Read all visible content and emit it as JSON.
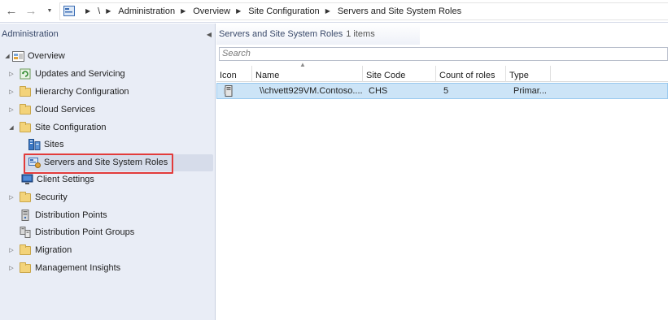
{
  "nav": {
    "back_glyph": "←",
    "forward_glyph": "→",
    "dropdown_glyph": "▼",
    "breadcrumb": [
      "\\",
      "Administration",
      "Overview",
      "Site Configuration",
      "Servers and Site System Roles"
    ]
  },
  "sidebar": {
    "title": "Administration",
    "collapse_glyph": "◀",
    "items": [
      {
        "label": "Overview",
        "icon": "overview-icon",
        "twisty": "◢"
      },
      {
        "label": "Updates and Servicing",
        "icon": "updates-icon",
        "twisty": "▷"
      },
      {
        "label": "Hierarchy Configuration",
        "icon": "folder-icon",
        "twisty": "▷"
      },
      {
        "label": "Cloud Services",
        "icon": "folder-icon",
        "twisty": "▷"
      },
      {
        "label": "Site Configuration",
        "icon": "folder-icon",
        "twisty": "◢"
      },
      {
        "label": "Sites",
        "icon": "sites-icon",
        "twisty": ""
      },
      {
        "label": "Servers and Site System Roles",
        "icon": "server-roles-icon",
        "twisty": ""
      },
      {
        "label": "Client Settings",
        "icon": "client-settings-icon",
        "twisty": ""
      },
      {
        "label": "Security",
        "icon": "folder-icon",
        "twisty": "▷"
      },
      {
        "label": "Distribution Points",
        "icon": "distribution-point-icon",
        "twisty": ""
      },
      {
        "label": "Distribution Point Groups",
        "icon": "distribution-group-icon",
        "twisty": ""
      },
      {
        "label": "Migration",
        "icon": "folder-icon",
        "twisty": "▷"
      },
      {
        "label": "Management Insights",
        "icon": "folder-icon",
        "twisty": "▷"
      }
    ]
  },
  "main": {
    "title": "Servers and Site System Roles",
    "count": "1 items",
    "search_placeholder": "Search",
    "columns": [
      "Icon",
      "Name",
      "Site Code",
      "Count of roles",
      "Type"
    ],
    "sort_glyph": "▲",
    "rows": [
      {
        "name": "\\\\chvett929VM.Contoso....",
        "site_code": "CHS",
        "count_of_roles": "5",
        "type": "Primar..."
      }
    ]
  },
  "colors": {
    "sidebar_bg": "#e9edf6",
    "selection": "#cce4f7",
    "highlight_border": "#e23b3b"
  }
}
